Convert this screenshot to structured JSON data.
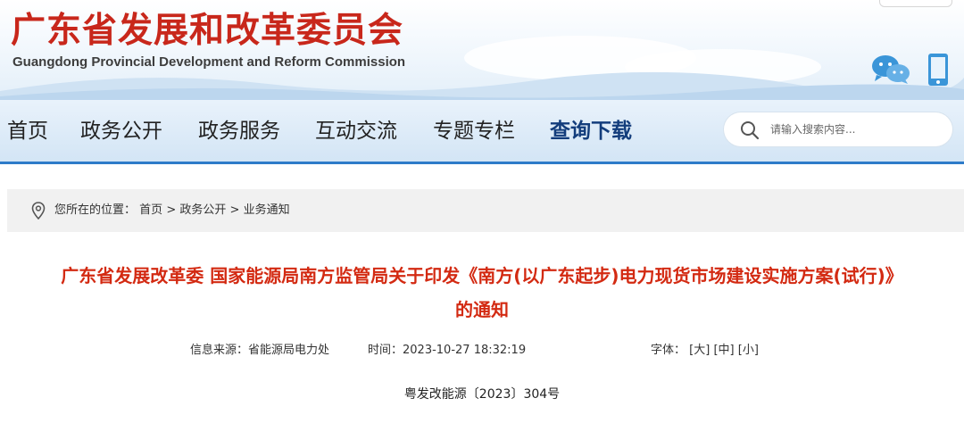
{
  "header": {
    "site_name_cn": "广东省发展和改革委员会",
    "site_name_en": "Guangdong Provincial Development and Reform Commission"
  },
  "icons": {
    "wechat": "wechat-icon",
    "mobile": "mobile-icon",
    "search": "search-icon",
    "location": "location-pin-icon"
  },
  "nav": {
    "items": [
      {
        "label": "首页"
      },
      {
        "label": "政务公开"
      },
      {
        "label": "政务服务"
      },
      {
        "label": "互动交流"
      },
      {
        "label": "专题专栏"
      },
      {
        "label": "查询下载"
      }
    ],
    "active_index": 5
  },
  "search": {
    "placeholder": "请输入搜索内容..."
  },
  "breadcrumb": {
    "prefix": "您所在的位置：",
    "items": [
      "首页",
      "政务公开",
      "业务通知"
    ],
    "sep": ">"
  },
  "article": {
    "title_line1": "广东省发展改革委 国家能源局南方监管局关于印发《南方(以广东起步)电力现货市场建设实施方案(试行)》",
    "title_line2": "的通知",
    "source_label": "信息来源：",
    "source": "省能源局电力处",
    "time_label": "时间：",
    "time": "2023-10-27 18:32:19",
    "font_label": "字体：",
    "font_sizes": [
      "[大]",
      "[中]",
      "[小]"
    ],
    "doc_number": "粤发改能源〔2023〕304号"
  },
  "colors": {
    "brand_red": "#c8271b",
    "title_red": "#d32a12",
    "nav_active": "#133d7c",
    "nav_border": "#2d7bc9"
  }
}
